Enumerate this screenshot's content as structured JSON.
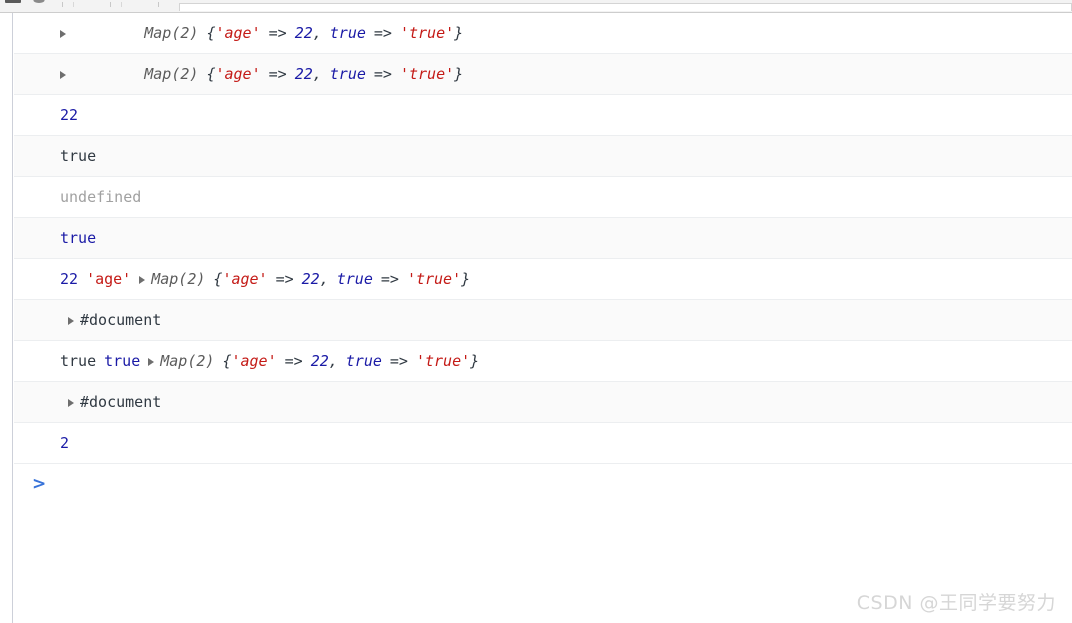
{
  "window": {
    "app": "Chrome DevTools Console",
    "panel": "Console"
  },
  "toolbar": {
    "clear_console_label": "clear-console",
    "eye_label": "inspect",
    "filter_placeholder": ""
  },
  "console": {
    "prompt_symbol": ">",
    "prompt_value": "",
    "prompt_placeholder": "",
    "disclosure_glyph": "▶",
    "colors": {
      "number": "#1a1aa6",
      "string": "#c41a16",
      "boolean": "#1a1aa6",
      "undefined": "#a1a1a1",
      "object": "#5c5c5c",
      "text": "#303942",
      "prompt": "#3873d9",
      "row_alt_background": "#fafafa",
      "row_background": "#ffffff",
      "row_divider": "#eceef0",
      "gutter_border": "#cdd0d9"
    },
    "rows": [
      {
        "kind": "map-preview",
        "type_label": "Map(2)",
        "open_brace": "{",
        "key1": "'age'",
        "arrow1": "=>",
        "value1": "22",
        "comma": ",",
        "key2": "true",
        "arrow2": "=>",
        "value2": "'true'",
        "close_brace": "}"
      },
      {
        "kind": "map-preview",
        "type_label": "Map(2)",
        "open_brace": "{",
        "key1": "'age'",
        "arrow1": "=>",
        "value1": "22",
        "comma": ",",
        "key2": "true",
        "arrow2": "=>",
        "value2": "'true'",
        "close_brace": "}"
      },
      {
        "kind": "number",
        "value": "22"
      },
      {
        "kind": "string",
        "value": "true"
      },
      {
        "kind": "undefined",
        "value": "undefined"
      },
      {
        "kind": "boolean",
        "value": "true"
      },
      {
        "kind": "number-string-map",
        "lead_number": "22",
        "lead_string": "'age'",
        "type_label": "Map(2)",
        "open_brace": "{",
        "key1": "'age'",
        "arrow1": "=>",
        "value1": "22",
        "comma": ",",
        "key2": "true",
        "arrow2": "=>",
        "value2": "'true'",
        "close_brace": "}"
      },
      {
        "kind": "node",
        "value": "#document"
      },
      {
        "kind": "bool-bool-map",
        "lead_string": "true",
        "lead_boolean": "true",
        "type_label": "Map(2)",
        "open_brace": "{",
        "key1": "'age'",
        "arrow1": "=>",
        "value1": "22",
        "comma": ",",
        "key2": "true",
        "arrow2": "=>",
        "value2": "'true'",
        "close_brace": "}"
      },
      {
        "kind": "node",
        "value": "#document"
      },
      {
        "kind": "number",
        "value": "2"
      }
    ]
  },
  "watermark": {
    "text": "CSDN @王同学要努力"
  }
}
